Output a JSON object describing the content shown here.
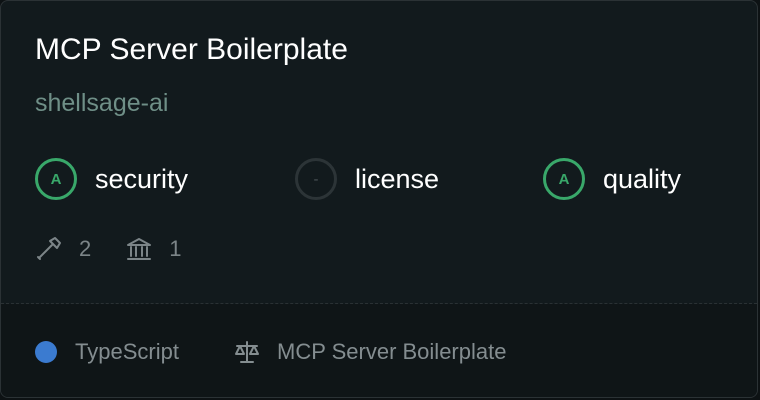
{
  "card": {
    "title": "MCP Server Boilerplate",
    "owner": "shellsage-ai",
    "grades": [
      {
        "label": "security",
        "grade": "A"
      },
      {
        "label": "license",
        "grade": "-"
      },
      {
        "label": "quality",
        "grade": "A"
      }
    ],
    "stats": {
      "tools_icon": "hammer-icon",
      "tools_count": "2",
      "resources_icon": "bank-icon",
      "resources_count": "1"
    },
    "footer": {
      "language": "TypeScript",
      "language_color": "#3b7bd0",
      "license_icon": "scale-icon",
      "license_text": "MCP Server Boilerplate"
    }
  },
  "colors": {
    "grade_pass": "#39a86a",
    "owner": "#6f8f87",
    "background": "#121a1d"
  }
}
